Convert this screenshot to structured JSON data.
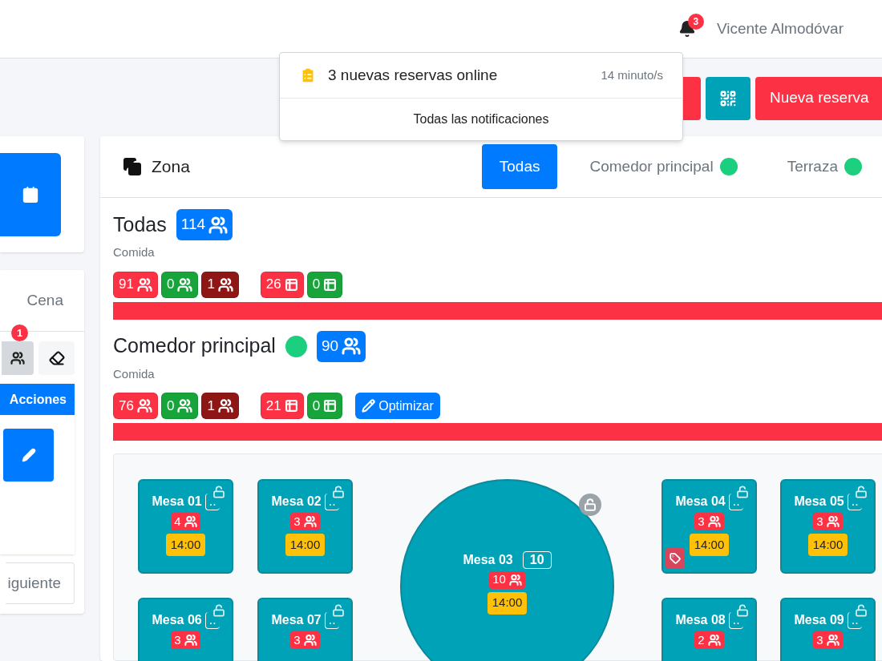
{
  "header": {
    "notification_count": "3",
    "user_name": "Vicente Almodóvar"
  },
  "notifications": {
    "items": [
      {
        "text": "3 nuevas reservas online",
        "time": "14 minuto/s"
      }
    ],
    "footer": "Todas las notificaciones"
  },
  "toolbar": {
    "new_button": "Nueva reserva"
  },
  "sidebar": {
    "shift_tab": {
      "label": "Cena",
      "selected": false
    },
    "filter_badge": "1",
    "filter_active": true,
    "actions_header": "Acciones",
    "next_button": "iguiente"
  },
  "zone_panel": {
    "title": "Zona",
    "tabs": [
      {
        "label": "Todas",
        "selected": true
      },
      {
        "label": "Comedor principal",
        "selected": false,
        "color": "#1ccf7e"
      },
      {
        "label": "Terraza",
        "selected": false,
        "color": "#1ccf7e"
      }
    ],
    "sections": [
      {
        "title": "Todas",
        "count": "114",
        "service": "Comida",
        "level": 1,
        "badges": [
          {
            "value": "91",
            "kind": "people",
            "color": "#fd3144"
          },
          {
            "value": "0",
            "kind": "people",
            "color": "#17a43b"
          },
          {
            "value": "1",
            "kind": "people",
            "color": "#8e1716"
          },
          {
            "value": "26",
            "kind": "tables",
            "color": "#fd3144"
          },
          {
            "value": "0",
            "kind": "tables",
            "color": "#17a43b"
          }
        ]
      },
      {
        "title": "Comedor principal",
        "color": "#1ccf7e",
        "count": "90",
        "service": "Comida",
        "level": 1,
        "optimize_button": "Optimizar",
        "badges": [
          {
            "value": "76",
            "kind": "people",
            "color": "#fd3144"
          },
          {
            "value": "0",
            "kind": "people",
            "color": "#17a43b"
          },
          {
            "value": "1",
            "kind": "people",
            "color": "#8e1716"
          },
          {
            "value": "21",
            "kind": "tables",
            "color": "#fd3144"
          },
          {
            "value": "0",
            "kind": "tables",
            "color": "#17a43b"
          }
        ]
      }
    ]
  },
  "floor_plan": {
    "tables": [
      {
        "name": "Mesa 01",
        "kind": "square",
        "capacity": "..",
        "guests": "4",
        "time": "14:00",
        "tag": false
      },
      {
        "name": "Mesa 02",
        "kind": "square",
        "capacity": "..",
        "guests": "3",
        "time": "14:00",
        "tag": false
      },
      {
        "name": "Mesa 03",
        "kind": "round",
        "capacity": "10",
        "guests": "10",
        "time": "14:00",
        "tag": false
      },
      {
        "name": "Mesa 04",
        "kind": "square",
        "capacity": "..",
        "guests": "3",
        "time": "14:00",
        "tag": true
      },
      {
        "name": "Mesa 05",
        "kind": "square",
        "capacity": "..",
        "guests": "3",
        "time": "14:00",
        "tag": false
      },
      {
        "name": "Mesa 06",
        "kind": "square",
        "capacity": "..",
        "guests": "3",
        "tag": false
      },
      {
        "name": "Mesa 07",
        "kind": "square",
        "capacity": "..",
        "guests": "3",
        "tag": false
      },
      {
        "name": "Mesa 08",
        "kind": "square",
        "capacity": "..",
        "guests": "2",
        "tag": false
      },
      {
        "name": "Mesa 09",
        "kind": "square",
        "capacity": "..",
        "guests": "3",
        "tag": false
      }
    ]
  }
}
